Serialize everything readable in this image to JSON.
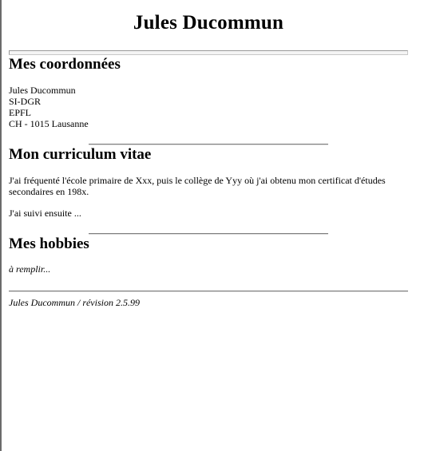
{
  "title": "Jules Ducommun",
  "contact": {
    "heading": "Mes coordonnées",
    "lines": [
      "Jules Ducommun",
      "SI-DGR",
      "EPFL",
      "CH - 1015 Lausanne"
    ]
  },
  "cv": {
    "heading": "Mon curriculum vitae",
    "paragraph1": "J'ai fréquenté l'école primaire de Xxx, puis le collège de Yyy où j'ai obtenu mon certificat d'études secondaires en 198x.",
    "paragraph2": "J'ai suivi ensuite ..."
  },
  "hobbies": {
    "heading": "Mes hobbies",
    "text": "à remplir..."
  },
  "footer": {
    "text": "Jules Ducommun / révision 2.5.99"
  }
}
